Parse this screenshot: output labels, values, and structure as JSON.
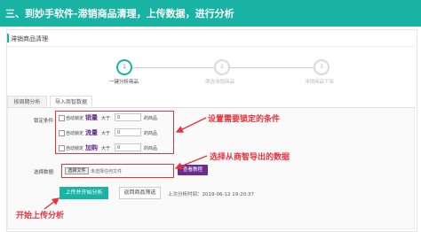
{
  "banner": {
    "title": "三、到妙手软件-滞销商品清理，上传数据，进行分析"
  },
  "panel": {
    "title": "滞销商品清理"
  },
  "steps": [
    {
      "number": "1",
      "label": "一键分析商品",
      "active": true
    },
    {
      "number": "2",
      "label": "筛选滞销商品",
      "active": false
    },
    {
      "number": "3",
      "label": "滞销商品下架",
      "active": false
    }
  ],
  "tabs": [
    {
      "label": "按周期分析",
      "active": false
    },
    {
      "label": "导入商智数据",
      "active": true
    }
  ],
  "form": {
    "lock_label": "锁定条件:",
    "conditions": [
      {
        "prefix": "自动锁定",
        "keyword": "销量",
        "comparator": "大于",
        "value": "0",
        "unit": "的商品"
      },
      {
        "prefix": "自动锁定",
        "keyword": "流量",
        "comparator": "大于",
        "value": "0",
        "unit": "的商品"
      },
      {
        "prefix": "自动锁定",
        "keyword": "加购",
        "comparator": "大于",
        "value": "0",
        "unit": "的商品"
      }
    ],
    "data_label": "选择数据:",
    "file_button": "选择文件",
    "file_status": "未选择任何文件",
    "tutorial_button": "查看教程",
    "upload_button": "上传并开始分析",
    "back_button": "返回商品筛选",
    "last_analysis": "上次分析时间：2019-06-12 19:20:37"
  },
  "annotations": {
    "set_lock": "设置需要锁定的条件",
    "choose_data": "选择从商智导出的数据",
    "start_upload": "开始上传分析"
  },
  "colors": {
    "brand": "#19b3a3",
    "annotation_red": "#e8323c",
    "keyword_purple": "#6a2d8f"
  }
}
